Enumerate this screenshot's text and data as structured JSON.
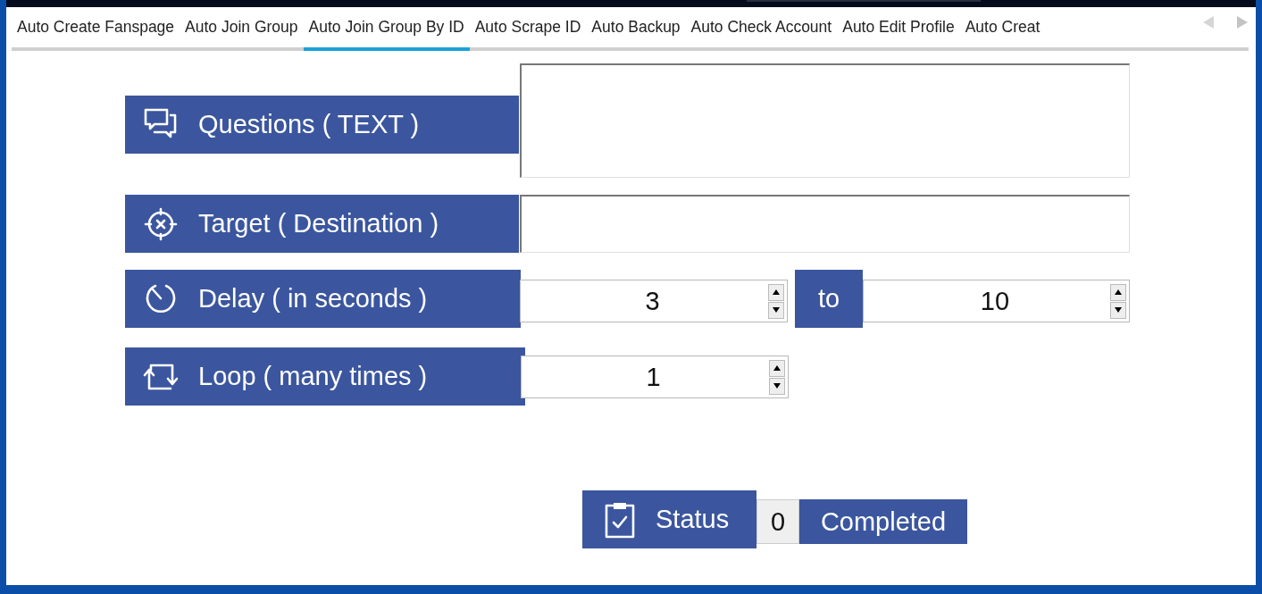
{
  "tabs": [
    {
      "label": "Auto Create Fanspage",
      "selected": false
    },
    {
      "label": "Auto Join Group",
      "selected": false
    },
    {
      "label": "Auto Join Group By ID",
      "selected": true
    },
    {
      "label": "Auto Scrape ID",
      "selected": false
    },
    {
      "label": "Auto Backup",
      "selected": false
    },
    {
      "label": "Auto Check Account",
      "selected": false
    },
    {
      "label": "Auto Edit Profile",
      "selected": false
    },
    {
      "label": "Auto Creat",
      "selected": false
    }
  ],
  "rows": [
    {
      "kind": "textarea",
      "label": "Questions ( TEXT )"
    },
    {
      "kind": "text",
      "label": "Target ( Destination )"
    },
    {
      "kind": "range",
      "label": "Delay ( in seconds )",
      "from": "3",
      "separator": "to",
      "to": "10"
    },
    {
      "kind": "number",
      "label": "Loop ( many times )",
      "value": "1"
    }
  ],
  "status": {
    "label": "Status",
    "count": "0",
    "suffix": "Completed"
  }
}
